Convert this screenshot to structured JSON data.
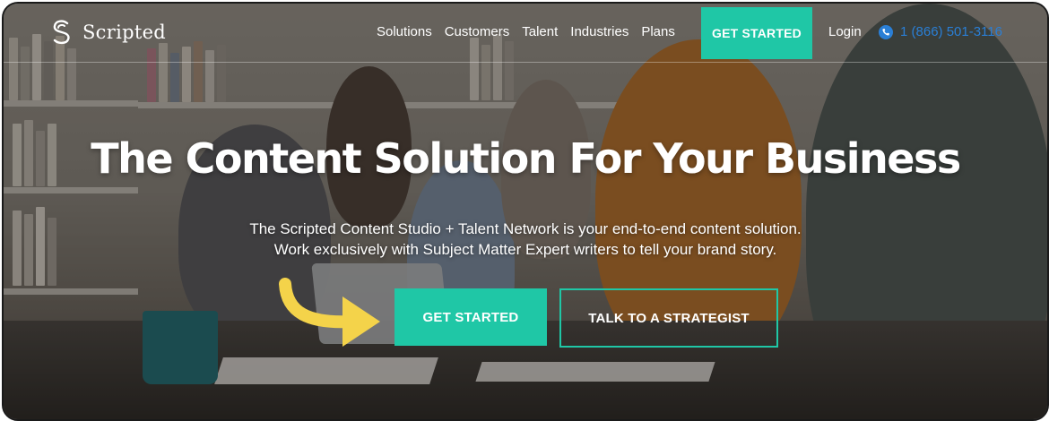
{
  "brand": {
    "name": "Scripted",
    "accent_color": "#1fc7a6",
    "phone_color": "#2a7fd6"
  },
  "nav": {
    "items": [
      "Solutions",
      "Customers",
      "Talent",
      "Industries",
      "Plans"
    ],
    "cta_label": "GET STARTED",
    "login_label": "Login",
    "phone_icon": "phone-icon",
    "phone_number": "1 (866) 501-3116"
  },
  "hero": {
    "title": "The Content Solution For Your Business",
    "subtitle_lines": [
      "The Scripted Content Studio + Talent Network is your end-to-end content solution.",
      "Work exclusively with Subject Matter Expert writers to tell your brand story."
    ],
    "primary_button": "GET STARTED",
    "secondary_button": "TALK TO A STRATEGIST",
    "arrow_icon": "curved-arrow-icon",
    "arrow_color": "#f4d34a"
  }
}
